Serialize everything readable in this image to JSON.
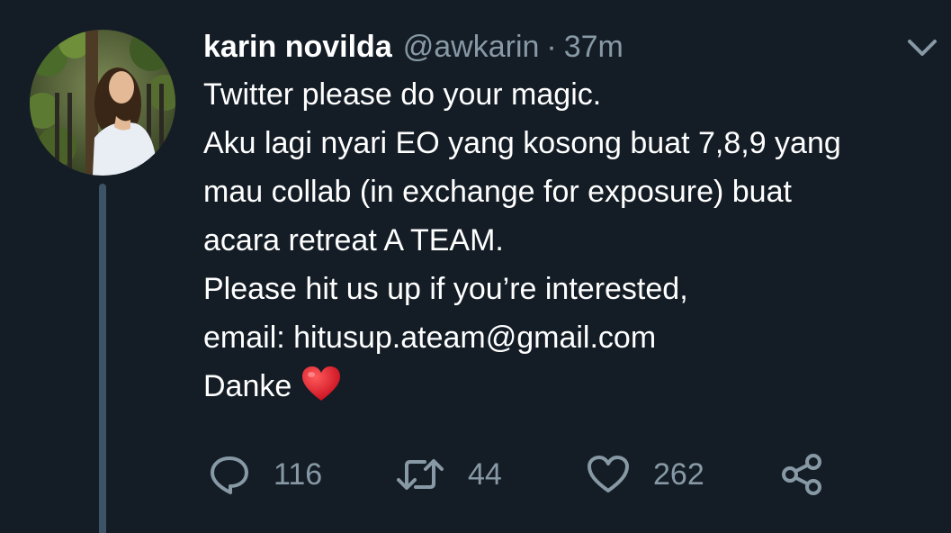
{
  "tweet": {
    "author_name": "karin novilda",
    "handle": "@awkarin",
    "separator": "·",
    "time": "37m",
    "lines": [
      "Twitter please do your magic.",
      "Aku lagi nyari EO yang kosong buat 7,8,9 yang",
      "mau collab (in exchange for exposure) buat",
      "acara retreat A TEAM.",
      "Please hit us up if you’re interested,",
      "email: hitusup.ateam@gmail.com",
      "Danke"
    ],
    "emoji": "red-heart"
  },
  "actions": {
    "reply_count": "116",
    "retweet_count": "44",
    "like_count": "262"
  },
  "icons": {
    "reply": "reply-icon",
    "retweet": "retweet-icon",
    "like": "like-icon",
    "share": "share-icon",
    "menu": "chevron-down-icon"
  },
  "colors": {
    "background": "#141d26",
    "text": "#ffffff",
    "secondary": "#8899a6",
    "thread_line": "#3d5466",
    "heart": "#e0162b"
  }
}
